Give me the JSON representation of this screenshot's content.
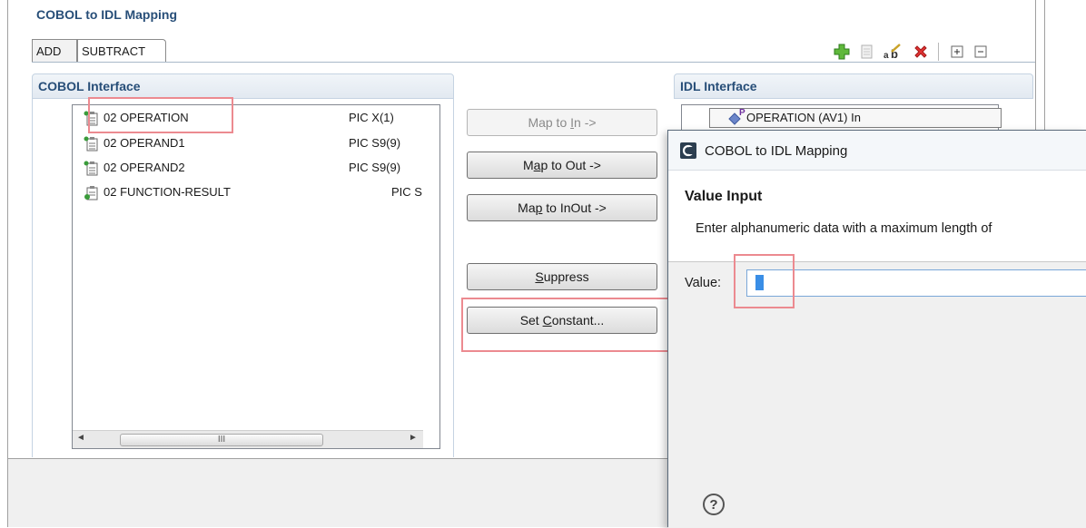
{
  "editor": {
    "title": "COBOL to IDL Mapping",
    "tabs": [
      {
        "label": "ADD"
      },
      {
        "label": "SUBTRACT"
      }
    ],
    "toolbar_icons": [
      "add-icon",
      "copy-icon",
      "rename-icon",
      "delete-icon",
      "expand-all-icon",
      "collapse-all-icon"
    ]
  },
  "cobol": {
    "header": "COBOL Interface",
    "rows": [
      {
        "name": "02 OPERATION",
        "pic": "PIC X(1)"
      },
      {
        "name": "02 OPERAND1",
        "pic": "PIC S9(9)"
      },
      {
        "name": "02 OPERAND2",
        "pic": "PIC S9(9)"
      },
      {
        "name": "02 FUNCTION-RESULT",
        "pic": "PIC S"
      }
    ],
    "hscroll_thumb": "III"
  },
  "buttons": {
    "map_in_pre": "Map to ",
    "map_in_u": "I",
    "map_in_post": "n ->",
    "map_out_pre": "M",
    "map_out_u": "a",
    "map_out_post": "p to Out ->",
    "map_inout_pre": "Ma",
    "map_inout_u": "p",
    "map_inout_post": " to InOut ->",
    "suppress_u": "S",
    "suppress_post": "uppress",
    "set_constant_pre": "Set ",
    "set_constant_u": "C",
    "set_constant_post": "onstant..."
  },
  "idl": {
    "header": "IDL Interface",
    "item_superscript": "P",
    "item_label": "OPERATION  (AV1)  In"
  },
  "dialog": {
    "title": "COBOL to IDL Mapping",
    "header_title": "Value Input",
    "header_message": "Enter alphanumeric data with a maximum length of",
    "value_label": "Value:",
    "value": "",
    "help": "?"
  }
}
